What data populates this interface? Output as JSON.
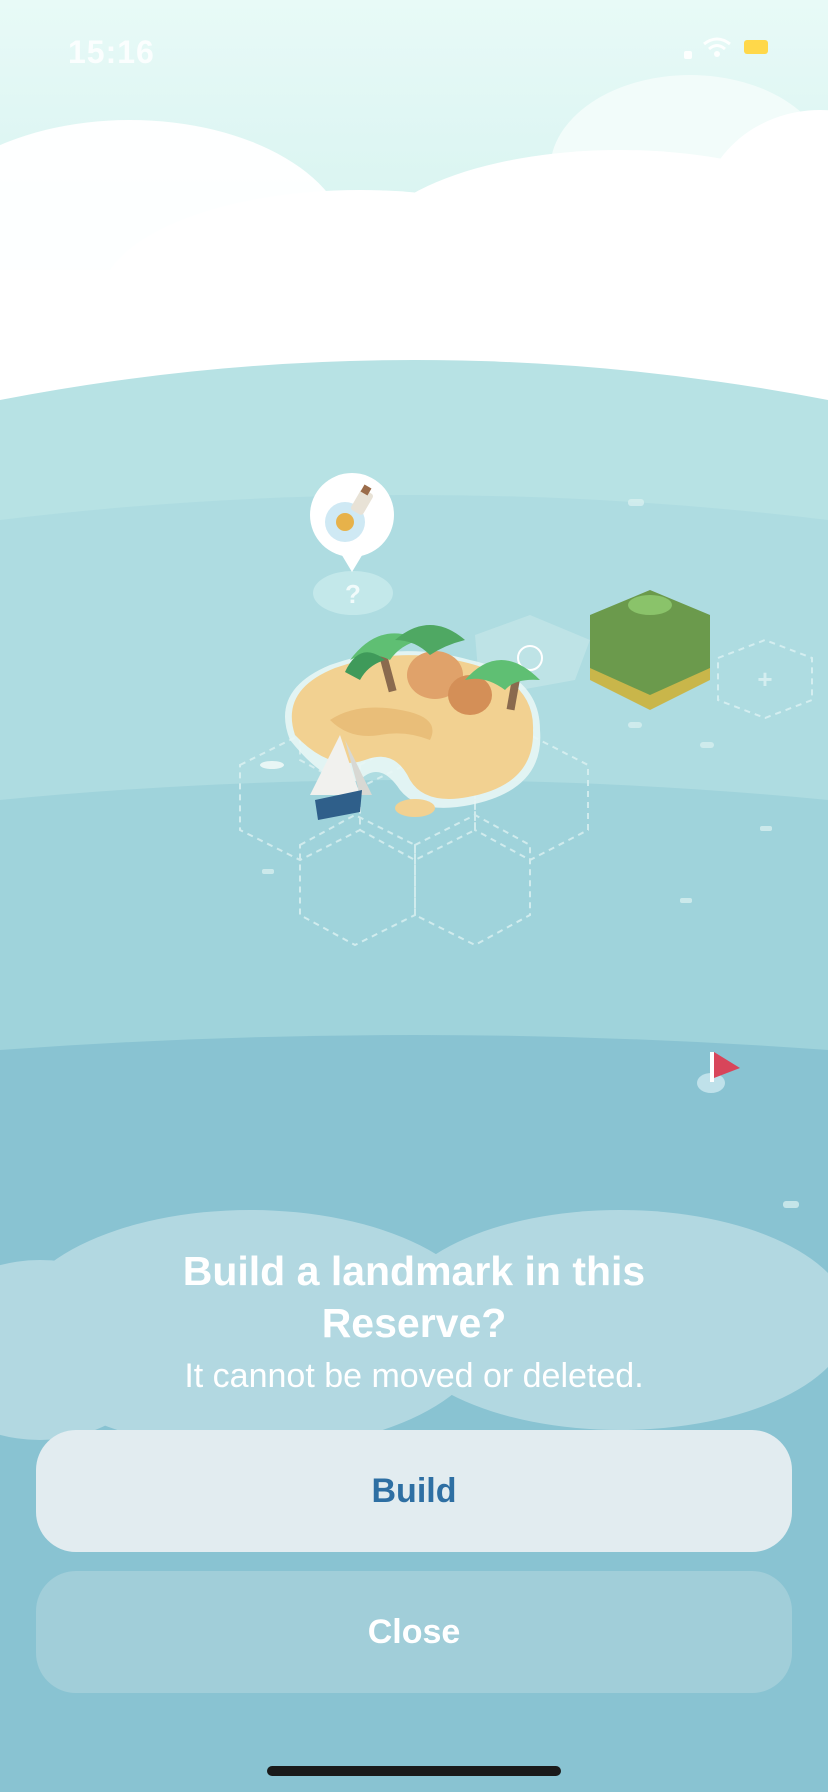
{
  "status_bar": {
    "time": "15:16"
  },
  "map": {
    "bubble_icon": "message-bottle-icon",
    "bubble_mark": "?",
    "locked_tile_mark": "+"
  },
  "dialog": {
    "title_line1": "Build a landmark in this",
    "title_line2": "Reserve?",
    "subtitle": "It cannot be moved or deleted.",
    "build_label": "Build",
    "close_label": "Close"
  },
  "colors": {
    "accent": "#2e6fa3",
    "build_button_bg": "#e2ecf0",
    "battery": "#ffd84a"
  }
}
